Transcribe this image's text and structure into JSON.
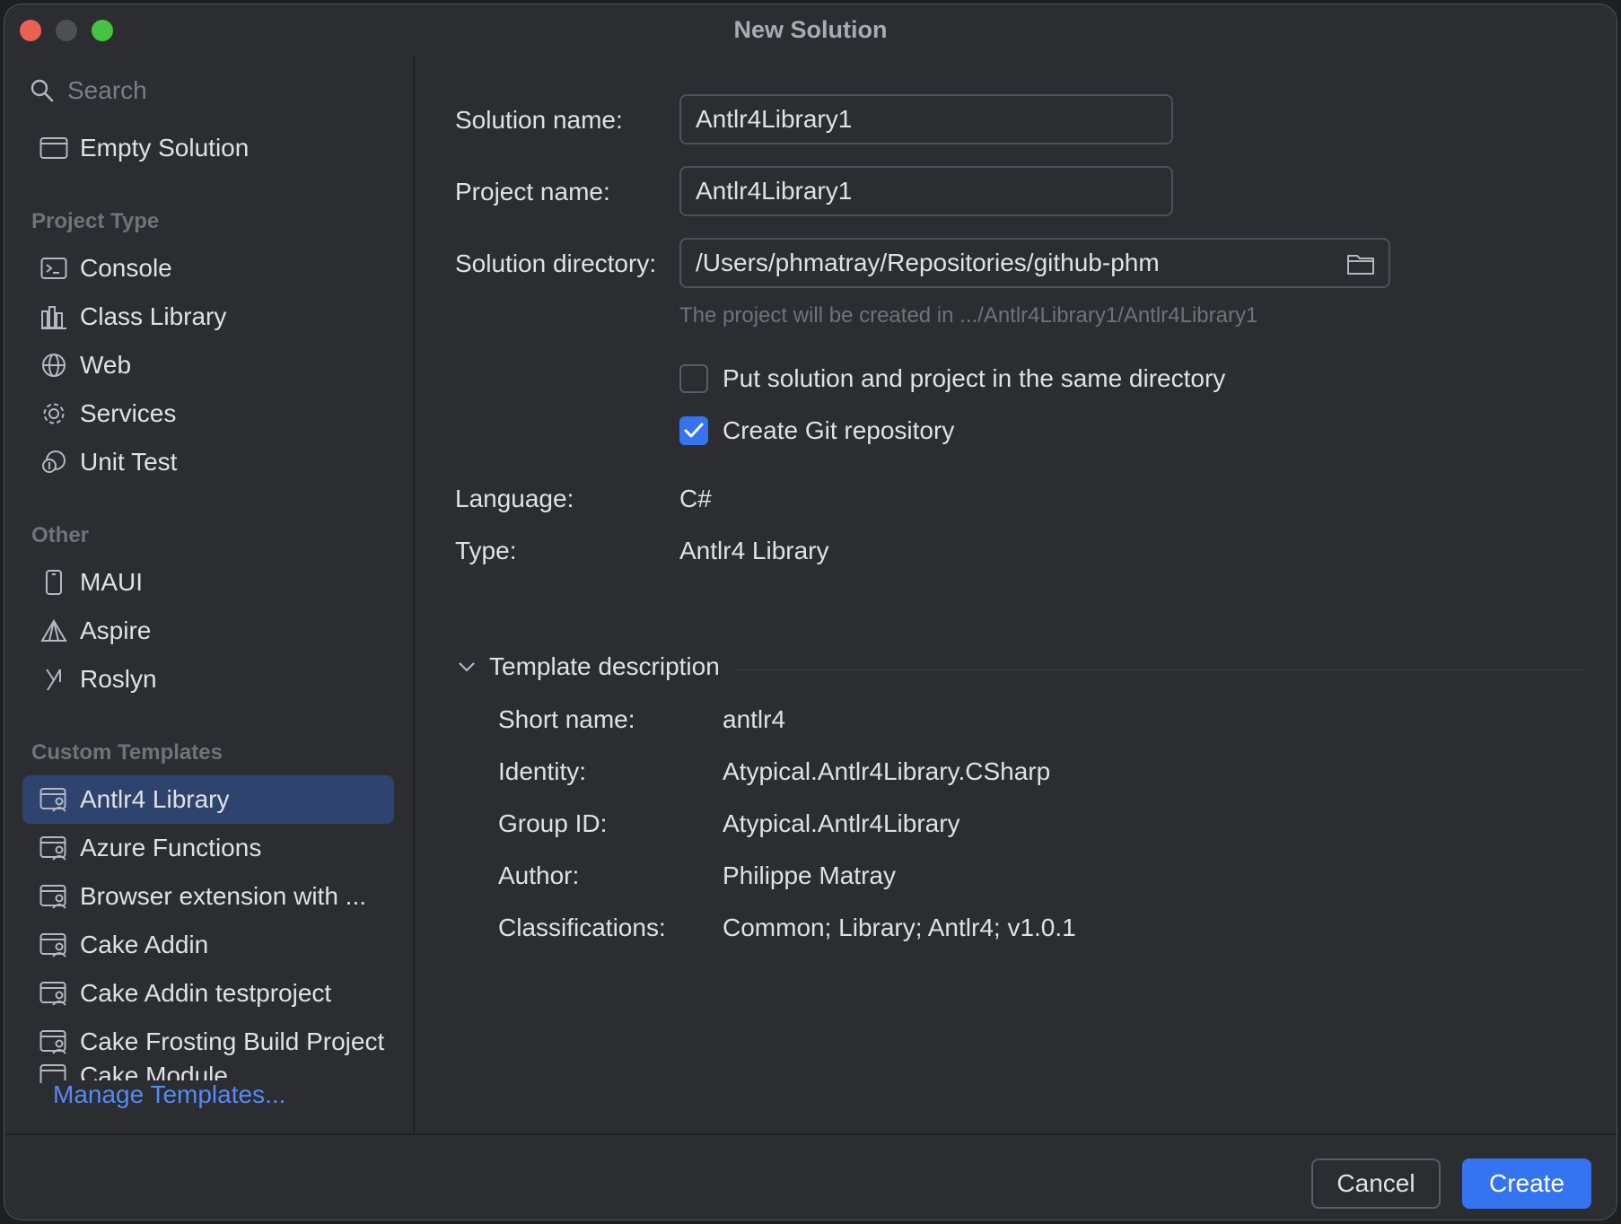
{
  "window": {
    "title": "New Solution"
  },
  "sidebar": {
    "search_placeholder": "Search",
    "empty_solution": "Empty Solution",
    "sections": {
      "project_type": "Project Type",
      "other": "Other",
      "custom_templates": "Custom Templates"
    },
    "project_types": [
      {
        "label": "Console",
        "icon": "console-icon"
      },
      {
        "label": "Class Library",
        "icon": "class-library-icon"
      },
      {
        "label": "Web",
        "icon": "globe-icon"
      },
      {
        "label": "Services",
        "icon": "gear-icon"
      },
      {
        "label": "Unit Test",
        "icon": "unit-test-icon"
      }
    ],
    "other": [
      {
        "label": "MAUI",
        "icon": "phone-icon"
      },
      {
        "label": "Aspire",
        "icon": "aspire-icon"
      },
      {
        "label": "Roslyn",
        "icon": "roslyn-icon"
      }
    ],
    "custom_templates": [
      {
        "label": "Antlr4 Library",
        "icon": "template-icon",
        "selected": true
      },
      {
        "label": "Azure Functions",
        "icon": "template-icon"
      },
      {
        "label": "Browser extension with ...",
        "icon": "template-icon"
      },
      {
        "label": "Cake Addin",
        "icon": "template-icon"
      },
      {
        "label": "Cake Addin testproject",
        "icon": "template-icon"
      },
      {
        "label": "Cake Frosting Build Project",
        "icon": "template-icon"
      },
      {
        "label": "Cake Module",
        "icon": "template-icon"
      }
    ],
    "manage_templates": "Manage Templates..."
  },
  "form": {
    "solution_name_label": "Solution name:",
    "solution_name_value": "Antlr4Library1",
    "project_name_label": "Project name:",
    "project_name_value": "Antlr4Library1",
    "solution_directory_label": "Solution directory:",
    "solution_directory_value": "/Users/phmatray/Repositories/github-phm",
    "hint": "The project will be created in .../Antlr4Library1/Antlr4Library1",
    "same_directory_label": "Put solution and project in the same directory",
    "same_directory_checked": false,
    "git_repo_label": "Create Git repository",
    "git_repo_checked": true,
    "language_label": "Language:",
    "language_value": "C#",
    "type_label": "Type:",
    "type_value": "Antlr4 Library"
  },
  "template_description": {
    "header": "Template description",
    "expanded": true,
    "rows": [
      {
        "label": "Short name:",
        "value": "antlr4"
      },
      {
        "label": "Identity:",
        "value": "Atypical.Antlr4Library.CSharp"
      },
      {
        "label": "Group ID:",
        "value": "Atypical.Antlr4Library"
      },
      {
        "label": "Author:",
        "value": "Philippe Matray"
      },
      {
        "label": "Classifications:",
        "value": "Common; Library; Antlr4; v1.0.1"
      }
    ]
  },
  "footer": {
    "cancel_label": "Cancel",
    "create_label": "Create"
  },
  "colors": {
    "accent": "#3574f0",
    "selection": "#2e436e",
    "link": "#548af7"
  }
}
